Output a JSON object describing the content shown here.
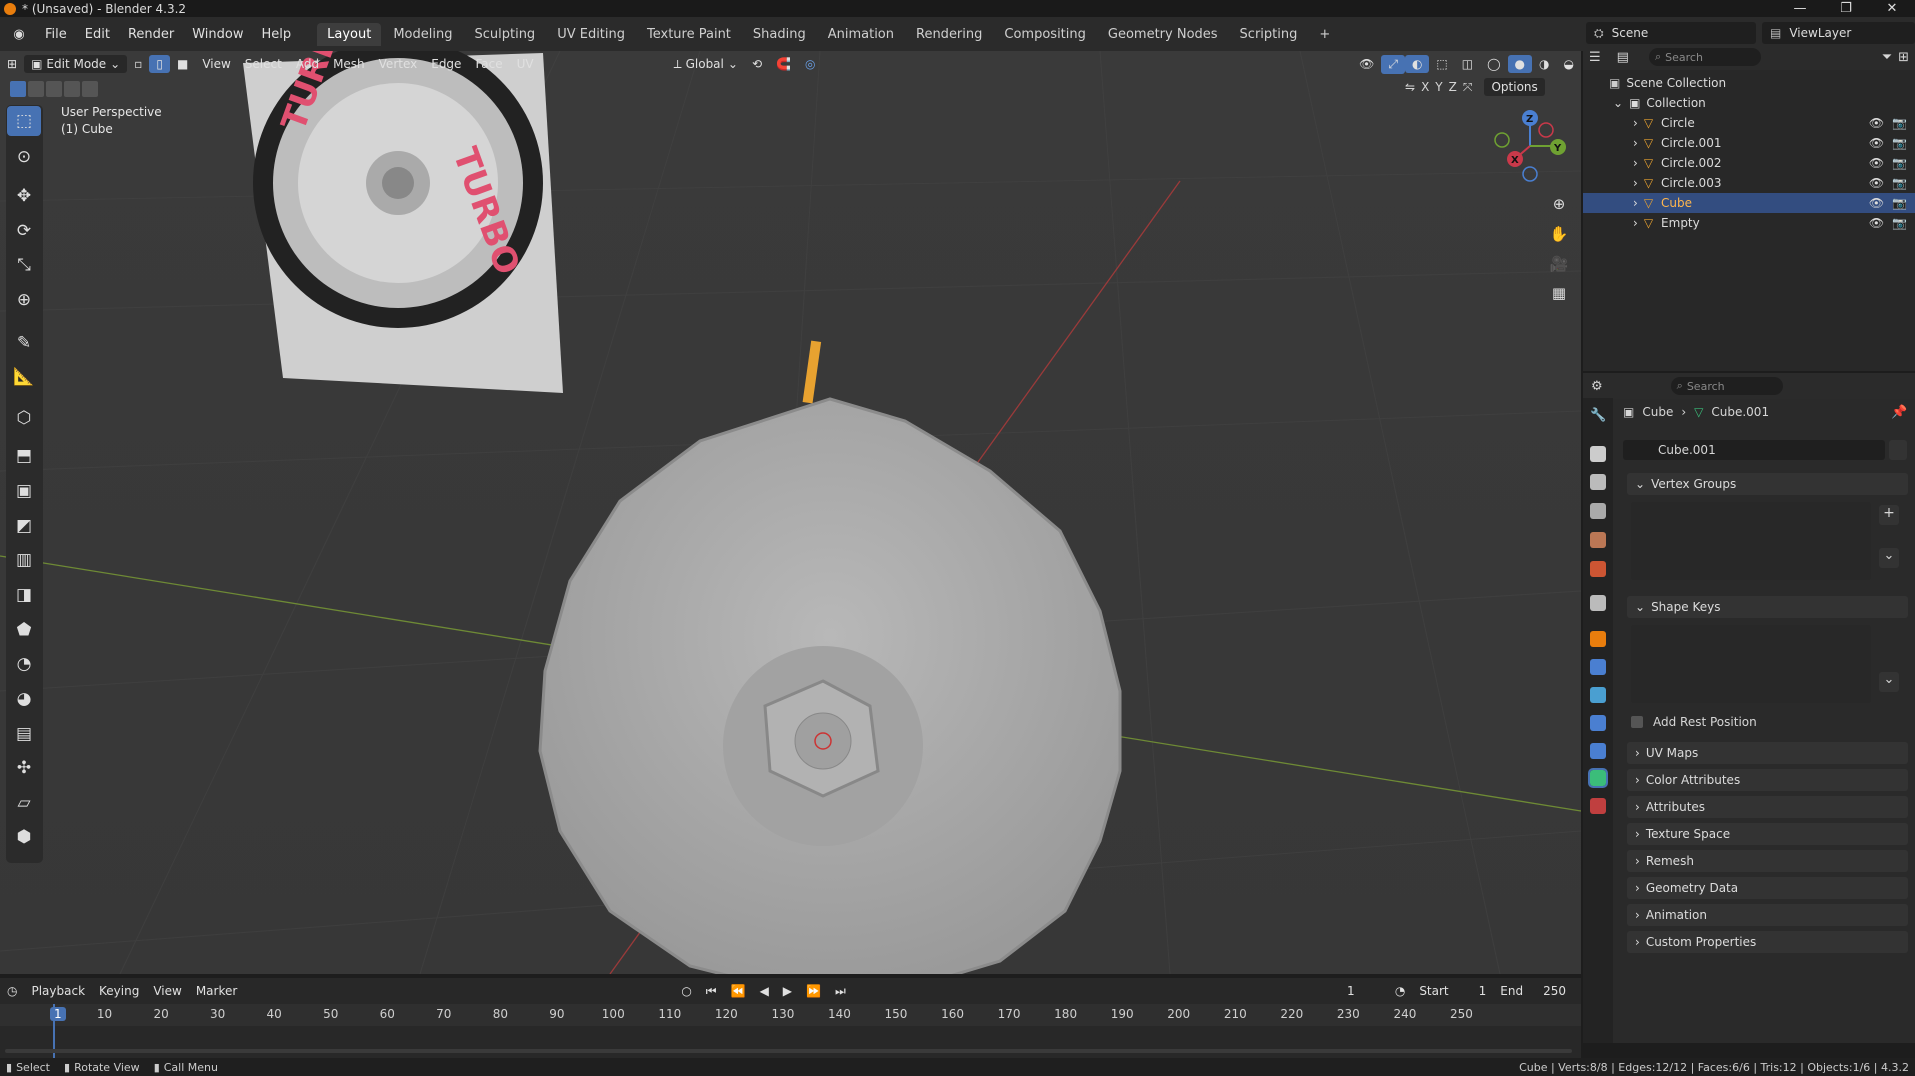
{
  "window": {
    "title": "* (Unsaved) - Blender 4.3.2",
    "controls": [
      "—",
      "❐",
      "✕"
    ]
  },
  "topbar": {
    "menus": [
      "File",
      "Edit",
      "Render",
      "Window",
      "Help"
    ],
    "workspaces": [
      "Layout",
      "Modeling",
      "Sculpting",
      "UV Editing",
      "Texture Paint",
      "Shading",
      "Animation",
      "Rendering",
      "Compositing",
      "Geometry Nodes",
      "Scripting"
    ],
    "add_tab": "+",
    "scene": "Scene",
    "view_layer": "ViewLayer"
  },
  "viewport_header": {
    "mode": "Edit Mode",
    "menus": [
      "View",
      "Select",
      "Add",
      "Mesh",
      "Vertex",
      "Edge",
      "Face",
      "UV"
    ],
    "transform_orientation": "Global",
    "options": "Options",
    "axes": [
      "X",
      "Y",
      "Z"
    ]
  },
  "viewport": {
    "perspective": "User Perspective",
    "object": "(1) Cube",
    "gizmo_labels": [
      "Z",
      "X",
      "Y"
    ]
  },
  "outliner": {
    "search_placeholder": "Search",
    "scene_collection": "Scene Collection",
    "collection": "Collection",
    "items": [
      {
        "name": "Circle",
        "selected": false
      },
      {
        "name": "Circle.001",
        "selected": false
      },
      {
        "name": "Circle.002",
        "selected": false
      },
      {
        "name": "Circle.003",
        "selected": false
      },
      {
        "name": "Cube",
        "selected": true
      },
      {
        "name": "Empty",
        "selected": false
      }
    ]
  },
  "properties": {
    "search_placeholder": "Search",
    "breadcrumb_object": "Cube",
    "breadcrumb_data": "Cube.001",
    "data_name": "Cube.001",
    "vertex_groups": "Vertex Groups",
    "shape_keys": "Shape Keys",
    "add_rest_position": "Add Rest Position",
    "sections": [
      "UV Maps",
      "Color Attributes",
      "Attributes",
      "Texture Space",
      "Remesh",
      "Geometry Data",
      "Animation",
      "Custom Properties"
    ]
  },
  "timeline": {
    "menus": [
      "Playback",
      "Keying",
      "View",
      "Marker"
    ],
    "current_frame": "1",
    "start_label": "Start",
    "start": "1",
    "end_label": "End",
    "end": "250",
    "ticks": [
      "1",
      "10",
      "20",
      "30",
      "40",
      "50",
      "60",
      "70",
      "80",
      "90",
      "100",
      "110",
      "120",
      "130",
      "140",
      "150",
      "160",
      "170",
      "180",
      "190",
      "200",
      "210",
      "220",
      "230",
      "240",
      "250"
    ]
  },
  "statusbar": {
    "select": "Select",
    "rotate": "Rotate View",
    "call_menu": "Call Menu",
    "stats": "Cube | Verts:8/8 | Edges:12/12 | Faces:6/6 | Tris:12 | Objects:1/6 | 4.3.2"
  }
}
